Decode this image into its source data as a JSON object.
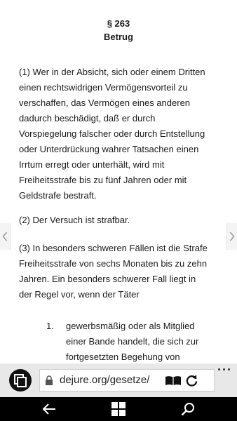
{
  "law": {
    "section": "§ 263",
    "title": "Betrug",
    "paragraphs": [
      [
        "(1) Wer in der Absicht, sich oder einem Dritten",
        "einen rechtswidrigen Vermögensvorteil zu",
        "verschaffen, das Vermögen eines anderen",
        "dadurch beschädigt, daß er durch",
        "Vorspiegelung falscher oder durch Entstellung",
        "oder Unterdrückung wahrer Tatsachen einen",
        "Irrtum erregt oder unterhält, wird mit",
        "Freiheitsstrafe bis zu fünf Jahren oder mit",
        "Geldstrafe bestraft."
      ],
      [
        "(2) Der Versuch ist strafbar."
      ],
      [
        "(3) In besonders schweren Fällen ist die Strafe",
        "Freiheitsstrafe von sechs Monaten bis zu zehn",
        "Jahren. Ein besonders schwerer Fall liegt in",
        "der Regel vor, wenn der Täter"
      ]
    ],
    "list": [
      {
        "number": "1.",
        "lines": [
          "gewerbsmäßig oder als Mitglied",
          "einer Bande handelt, die sich zur",
          "fortgesetzten Begehung von"
        ]
      }
    ]
  },
  "browser": {
    "url": "dejure.org/gesetze/",
    "icons": {
      "tabs": "tabs-icon",
      "lock": "lock-icon",
      "reader": "reading-view-icon",
      "reload": "refresh-icon",
      "more": "more-icon"
    }
  },
  "taskbar": {
    "icons": [
      "back-arrow-icon",
      "windows-logo-icon",
      "search-icon"
    ]
  },
  "colors": {
    "text": "#1a1a1a",
    "browser_bar": "#e8e8e8",
    "taskbar": "#000000"
  }
}
